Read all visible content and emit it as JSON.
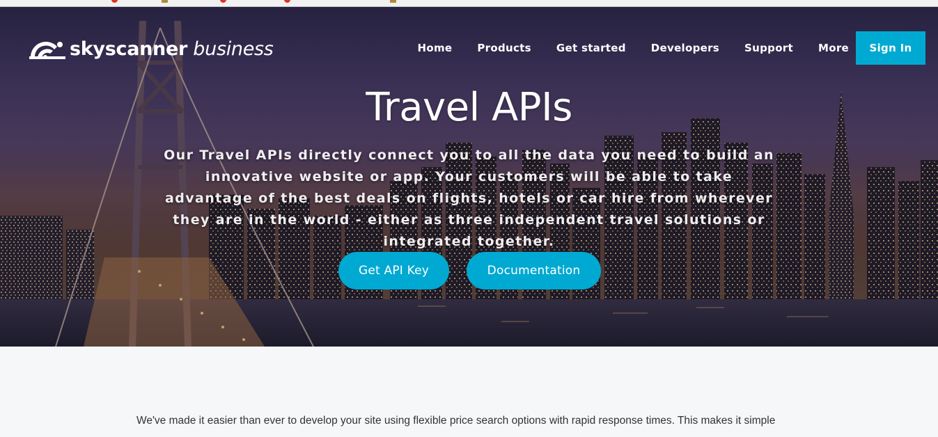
{
  "brand": {
    "name_bold": "skyscanner",
    "name_light": "business",
    "accent_color": "#00a9d1"
  },
  "nav": {
    "items": [
      "Home",
      "Products",
      "Get started",
      "Developers",
      "Support",
      "More"
    ],
    "sign_in": "Sign In"
  },
  "hero": {
    "title": "Travel APIs",
    "description": "Our Travel APIs directly connect you to all the data you need to build an innovative website or app. Your customers will be able to take advantage of the best deals on flights, hotels or car hire from wherever they are in the world - either as three independent travel solutions or integrated together.",
    "primary_button": "Get API Key",
    "secondary_button": "Documentation"
  },
  "content": {
    "intro": "We've made it easier than ever to develop your site using flexible price search options with rapid response times. This makes it simple"
  }
}
